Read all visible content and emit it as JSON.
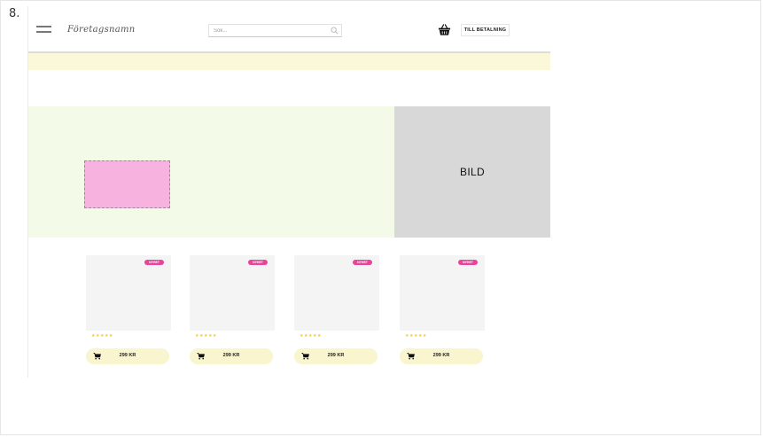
{
  "step": {
    "number": "8."
  },
  "header": {
    "brand": "Företagsnamn",
    "search": {
      "placeholder": "Sök...",
      "value": "",
      "icon": "search-icon"
    },
    "basket_icon": "basket-icon",
    "checkout_label": "TILL BETALNING"
  },
  "hero": {
    "image_label": "BILD"
  },
  "products": [
    {
      "badge": "NYHET",
      "rating": "★★★★★",
      "price": "299 KR"
    },
    {
      "badge": "NYHET",
      "rating": "★★★★★",
      "price": "299 KR"
    },
    {
      "badge": "NYHET",
      "rating": "★★★★★",
      "price": "299 KR"
    },
    {
      "badge": "NYHET",
      "rating": "★★★★★",
      "price": "299 KR"
    }
  ],
  "colors": {
    "announcement_bar": "#fbf8d9",
    "hero_background": "#f3fbe8",
    "hero_placeholder": "#f7b2e0",
    "image_placeholder": "#d8d8d8",
    "badge": "#e8449a",
    "rating": "#f0c93c",
    "price_button": "#f8f5cf"
  }
}
